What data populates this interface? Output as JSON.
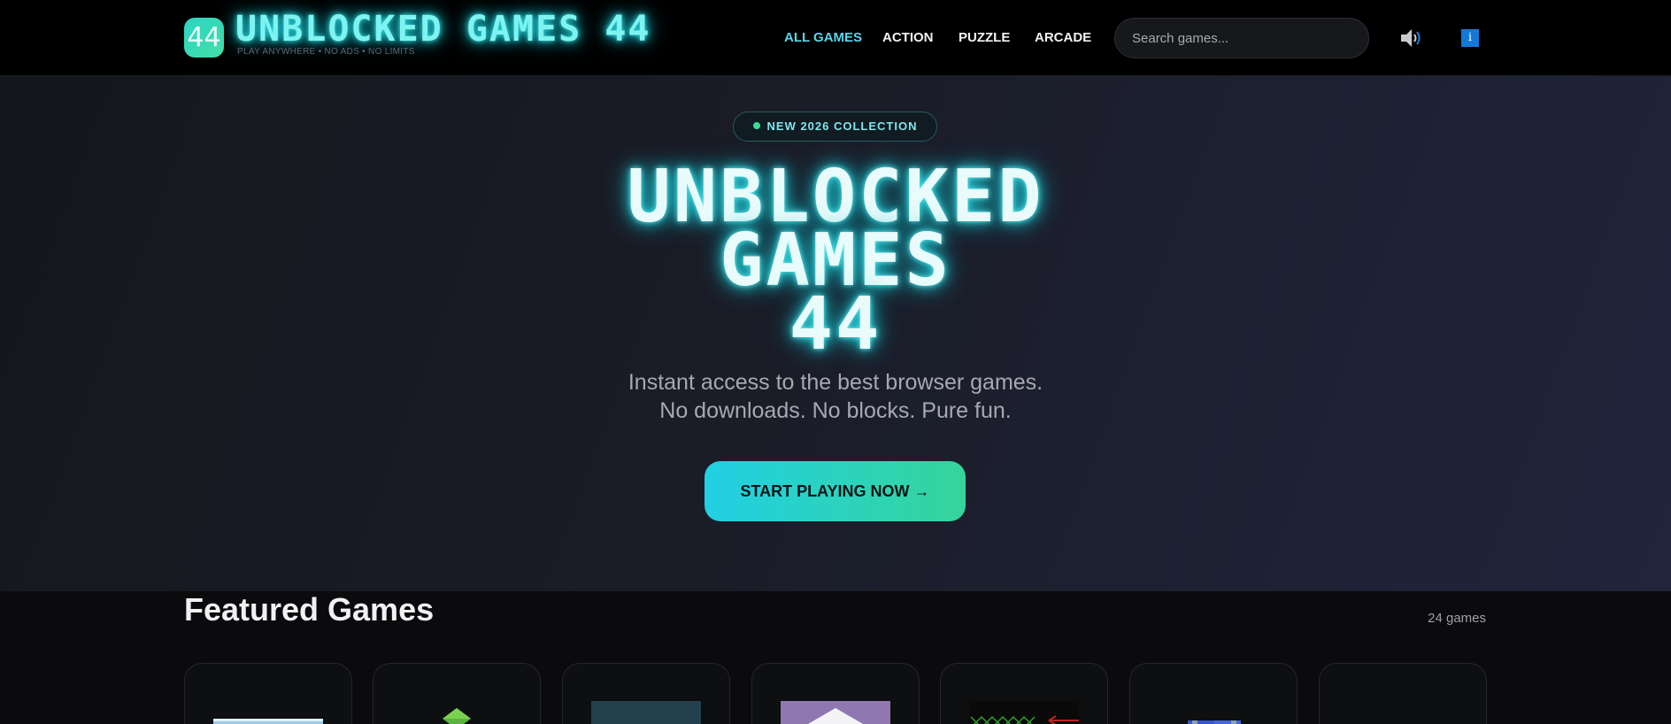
{
  "header": {
    "logo_badge": "44",
    "logo_title": "UNBLOCKED GAMES 44",
    "logo_subtitle": "PLAY ANYWHERE • NO ADS • NO LIMITS",
    "nav": [
      "ALL GAMES",
      "ACTION",
      "PUZZLE",
      "ARCADE"
    ],
    "active_nav": "ALL GAMES",
    "search_placeholder": "Search games...",
    "sound_icon": "speaker-volume-icon",
    "info_icon": "i"
  },
  "hero": {
    "pill": "NEW 2026 COLLECTION",
    "title_lines": [
      "UNBLOCKED",
      "GAMES",
      "44"
    ],
    "tagline_lines": [
      "Instant access to the best browser games.",
      "No downloads. No blocks. Pure fun."
    ],
    "cta": "START PLAYING NOW →"
  },
  "featured": {
    "title": "Featured Games",
    "count": "24 games",
    "cards": [
      {
        "thumb": "sky-scene"
      },
      {
        "thumb": "green-block"
      },
      {
        "thumb": "dark-teal"
      },
      {
        "thumb": "purple-peak"
      },
      {
        "thumb": "green-grid"
      },
      {
        "thumb": "blue-figures"
      },
      {
        "thumb": "empty"
      }
    ]
  },
  "colors": {
    "accent_cyan": "#56d6ec",
    "accent_green": "#35d59a",
    "background": "#0b0b0d"
  }
}
